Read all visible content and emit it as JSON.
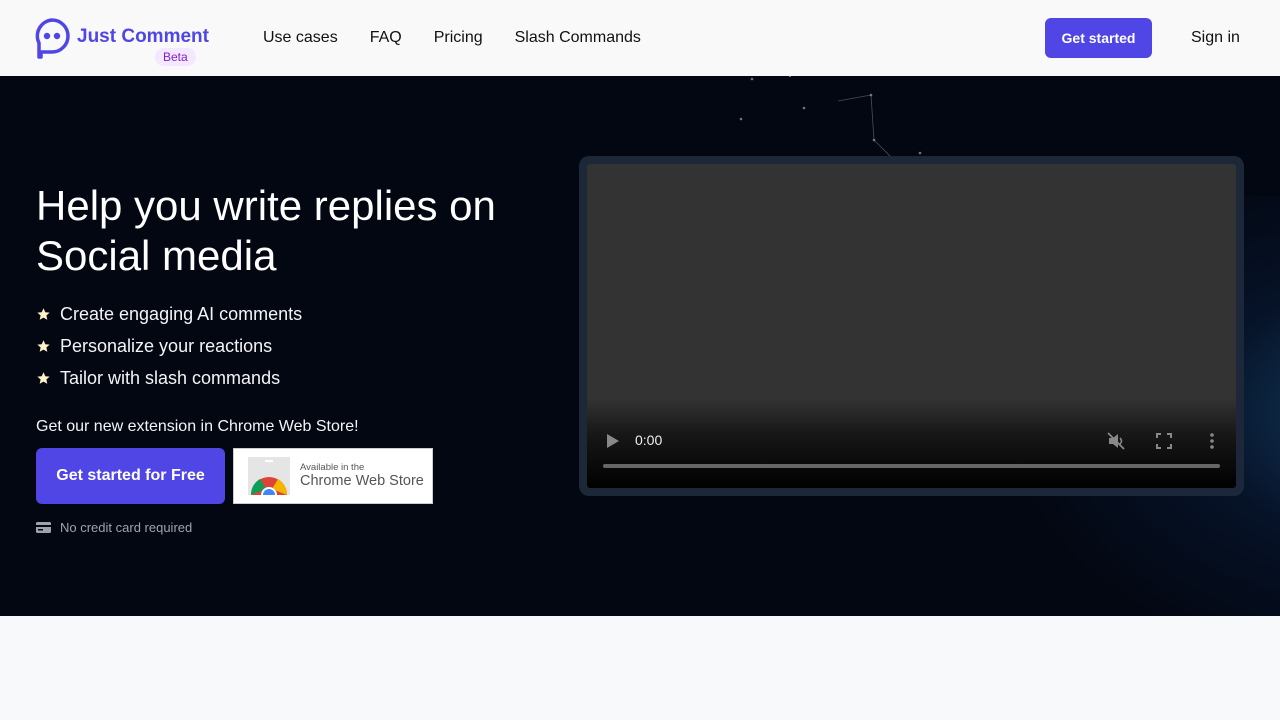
{
  "header": {
    "brand": "Just Comment",
    "badge": "Beta",
    "nav": [
      {
        "label": "Use cases"
      },
      {
        "label": "FAQ"
      },
      {
        "label": "Pricing"
      },
      {
        "label": "Slash Commands"
      }
    ],
    "cta_label": "Get started",
    "signin_label": "Sign in"
  },
  "hero": {
    "headline": "Help you write replies on Social media",
    "features": [
      {
        "icon": "star-icon",
        "text": "Create engaging AI comments"
      },
      {
        "icon": "star-icon",
        "text": "Personalize your reactions"
      },
      {
        "icon": "star-icon",
        "text": "Tailor with slash commands"
      }
    ],
    "extension_text": "Get our new extension in Chrome Web Store!",
    "cta_label": "Get started for Free",
    "cws_badge": {
      "line1": "Available in the",
      "line2": "Chrome Web Store"
    },
    "no_cc_text": "No credit card required"
  },
  "video": {
    "time": "0:00",
    "progress": 0,
    "muted": true
  },
  "colors": {
    "brand": "#4f46e5",
    "badge_text": "#7e22ce",
    "badge_bg": "#f3e8ff",
    "hero_bg": "#030712"
  }
}
